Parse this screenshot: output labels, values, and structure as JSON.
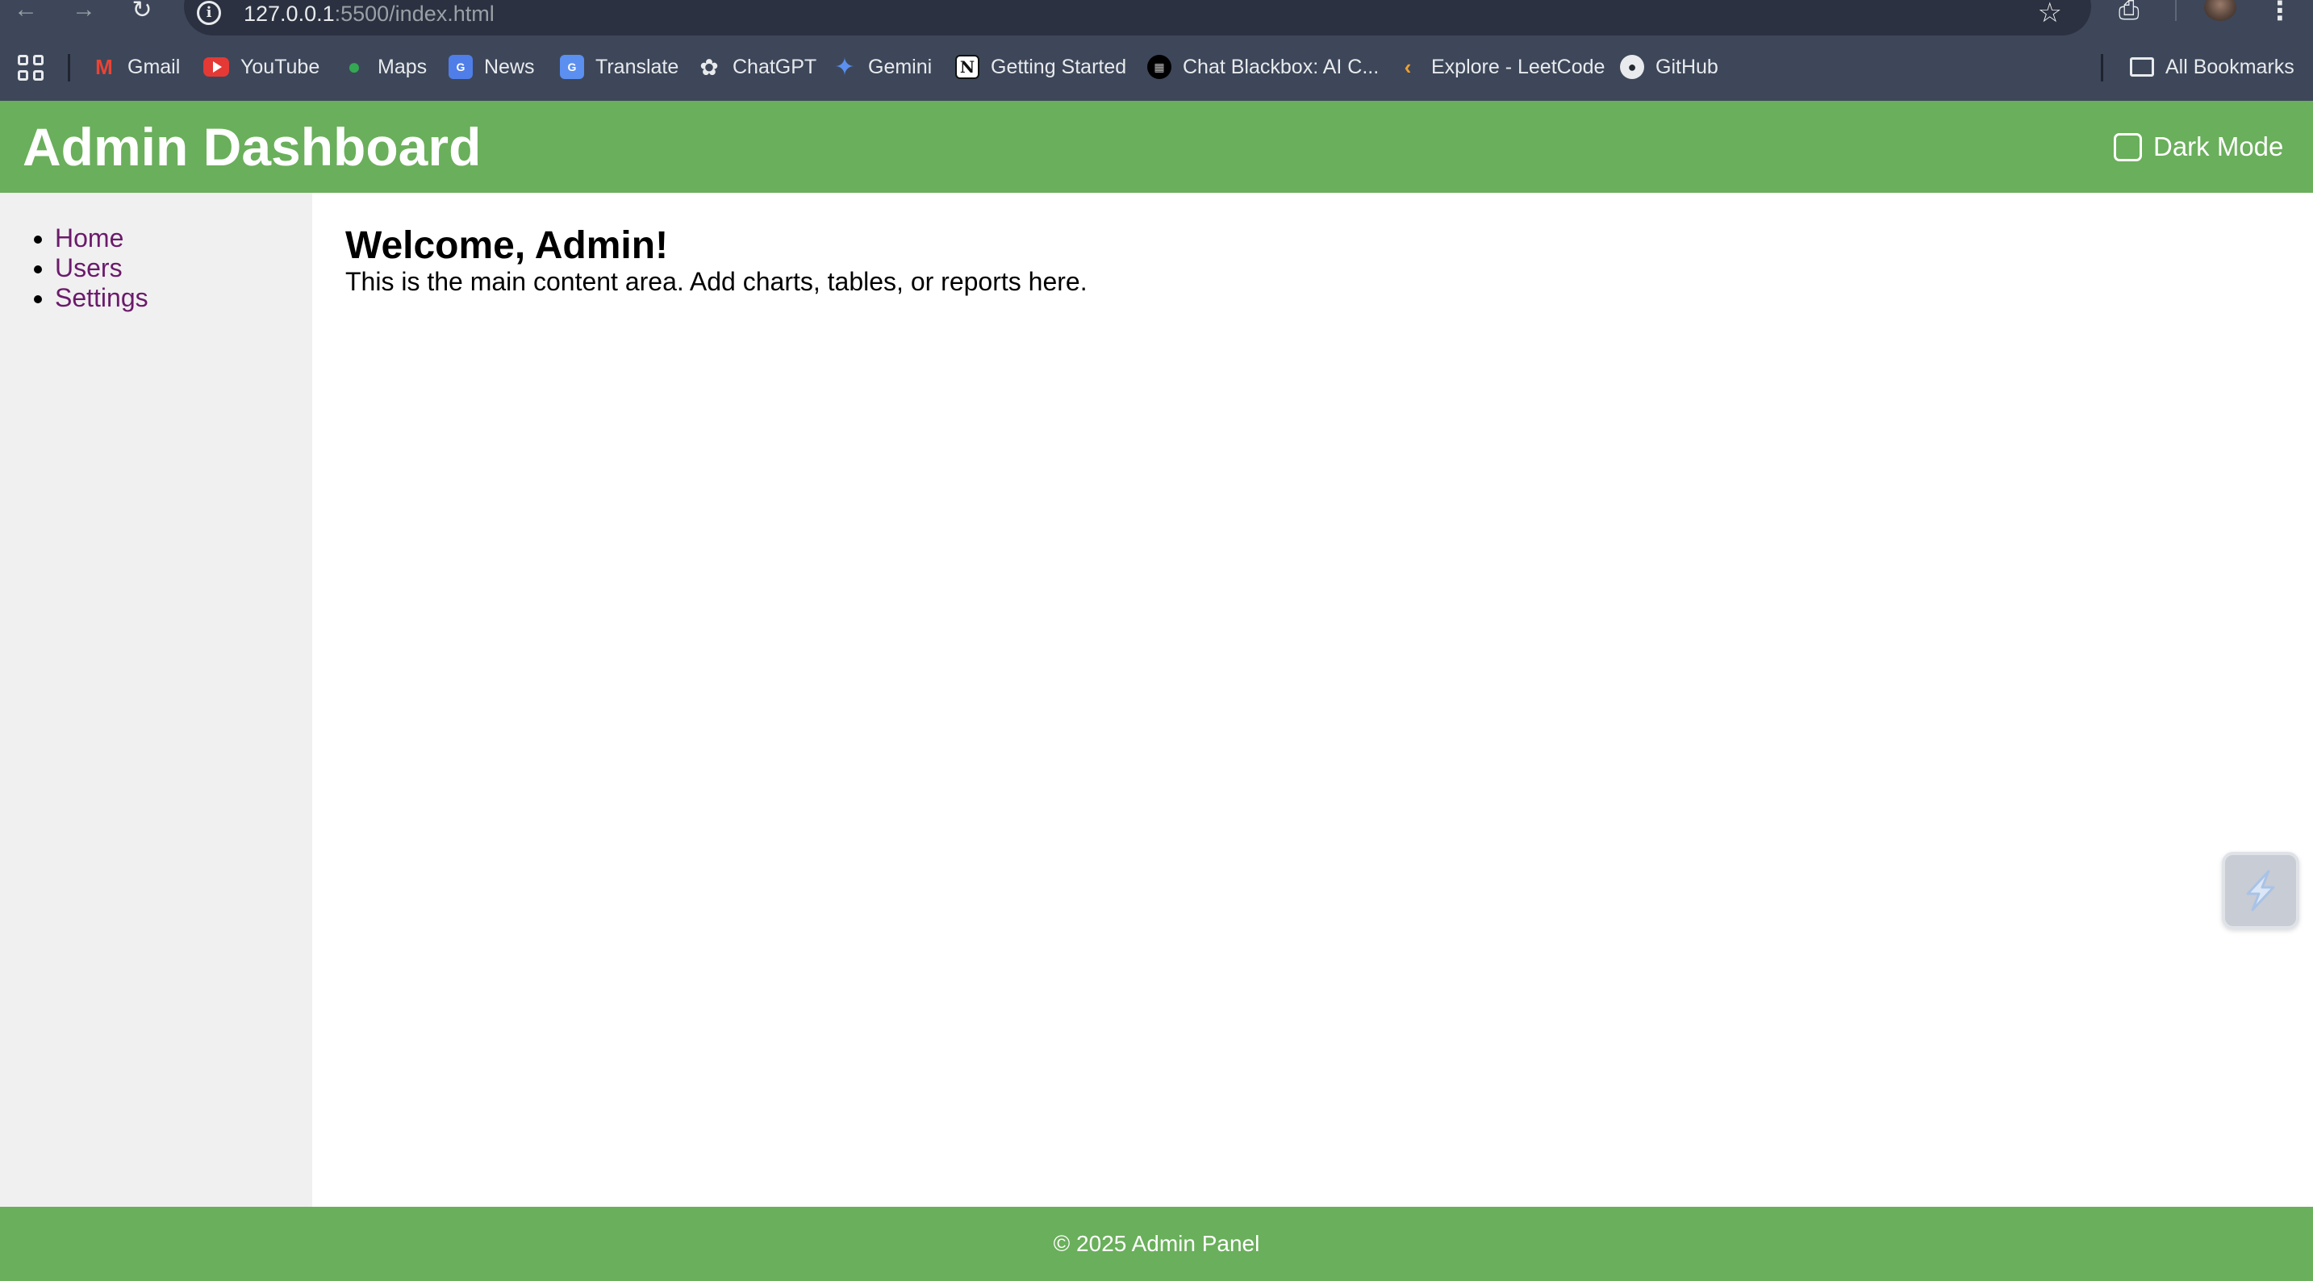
{
  "browser": {
    "url_host": "127.0.0.1",
    "url_rest": ":5500/index.html",
    "bookmarks": [
      {
        "label": "Gmail",
        "icon": "gmail-icon"
      },
      {
        "label": "YouTube",
        "icon": "youtube-icon"
      },
      {
        "label": "Maps",
        "icon": "maps-icon"
      },
      {
        "label": "News",
        "icon": "news-icon"
      },
      {
        "label": "Translate",
        "icon": "translate-icon"
      },
      {
        "label": "ChatGPT",
        "icon": "chatgpt-icon"
      },
      {
        "label": "Gemini",
        "icon": "gemini-icon"
      },
      {
        "label": "Getting Started",
        "icon": "notion-icon"
      },
      {
        "label": "Chat Blackbox: AI C...",
        "icon": "blackbox-icon"
      },
      {
        "label": "Explore - LeetCode",
        "icon": "leetcode-icon"
      },
      {
        "label": "GitHub",
        "icon": "github-icon"
      }
    ],
    "all_bookmarks_label": "All Bookmarks"
  },
  "header": {
    "title": "Admin Dashboard",
    "dark_mode_label": "Dark Mode",
    "dark_mode_checked": false
  },
  "sidebar": {
    "items": [
      {
        "label": "Home"
      },
      {
        "label": "Users"
      },
      {
        "label": "Settings"
      }
    ]
  },
  "main": {
    "heading": "Welcome, Admin!",
    "body": "This is the main content area. Add charts, tables, or reports here."
  },
  "footer": {
    "text": "© 2025 Admin Panel"
  },
  "colors": {
    "header_bg": "#6aaf5b",
    "sidebar_bg": "#f0f0f0",
    "link": "#6b1a6b",
    "chrome_bg": "#3d4759"
  }
}
